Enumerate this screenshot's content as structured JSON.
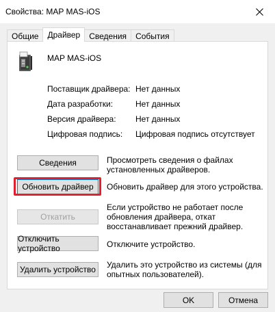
{
  "window": {
    "title": "Свойства: MAP MAS-iOS"
  },
  "tabs": [
    {
      "label": "Общие"
    },
    {
      "label": "Драйвер"
    },
    {
      "label": "Сведения"
    },
    {
      "label": "События"
    }
  ],
  "device": {
    "name": "MAP MAS-iOS",
    "icon": "device-icon"
  },
  "properties": [
    {
      "label": "Поставщик драйвера:",
      "value": "Нет данных"
    },
    {
      "label": "Дата разработки:",
      "value": "Нет данных"
    },
    {
      "label": "Версия драйвера:",
      "value": "Нет данных"
    },
    {
      "label": "Цифровая подпись:",
      "value": "Цифровая подпись отсутствует"
    }
  ],
  "actions": [
    {
      "label": "Сведения",
      "description": "Просмотреть сведения о файлах установленных драйверов."
    },
    {
      "label": "Обновить драйвер",
      "description": "Обновить драйвер для этого устройства."
    },
    {
      "label": "Откатить",
      "description": "Если устройство не работает после обновления драйвера, откат восстанавливает прежний драйвер."
    },
    {
      "label": "Отключить устройство",
      "description": "Отключите устройство."
    },
    {
      "label": "Удалить устройство",
      "description": "Удалить это устройство из системы (для опытных пользователей)."
    }
  ],
  "footer": {
    "ok_label": "OK",
    "cancel_label": "Отмена"
  },
  "colors": {
    "highlight": "#e0202d",
    "focus": "#0078d7"
  }
}
